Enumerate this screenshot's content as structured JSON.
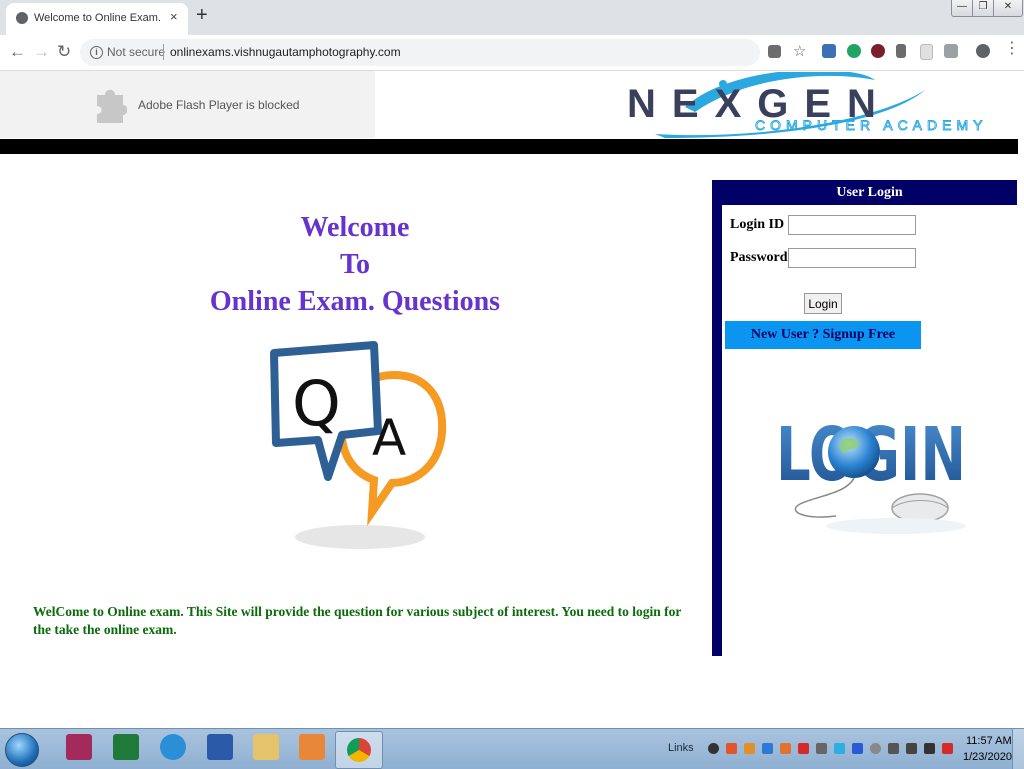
{
  "browser": {
    "tab_title": "Welcome to Online Exam.",
    "tab_close": "×",
    "new_tab": "+",
    "security_label": "Not secure",
    "url": "onlinexams.vishnugautamphotography.com",
    "nav": {
      "back": "←",
      "forward": "→",
      "reload": "↻"
    }
  },
  "window_buttons": {
    "minimize": "—",
    "maximize": "❐",
    "close": "✕"
  },
  "header": {
    "flash_notice": "Adobe Flash Player is blocked",
    "logo_main": "NEXGEN",
    "logo_sub": "COMPUTER ACADEMY",
    "colors": {
      "logo_text": "#3a3f5c",
      "logo_swoosh": "#2aa8df"
    }
  },
  "welcome": {
    "line1": "Welcome",
    "line2": "To",
    "line3": "Online Exam. Questions",
    "graphic_q": "Q",
    "graphic_a": "A",
    "intro": "WelCome to Online exam. This Site will provide the question for various subject of interest. You need to login for the take the online exam."
  },
  "login": {
    "title": "User Login",
    "login_id_label": "Login ID",
    "login_id_value": "",
    "password_label": "Password",
    "password_value": "",
    "button_label": "Login",
    "signup_label": "New User ? Signup Free",
    "graphic_text": "LOGIN",
    "colors": {
      "panel": "#000066",
      "signup_bg": "#0a96f0",
      "welcome_text": "#6633cc",
      "intro_text": "#0b6b0b"
    }
  },
  "taskbar": {
    "links_label": "Links",
    "clock_time": "11:57 AM",
    "clock_date": "1/23/2020"
  }
}
